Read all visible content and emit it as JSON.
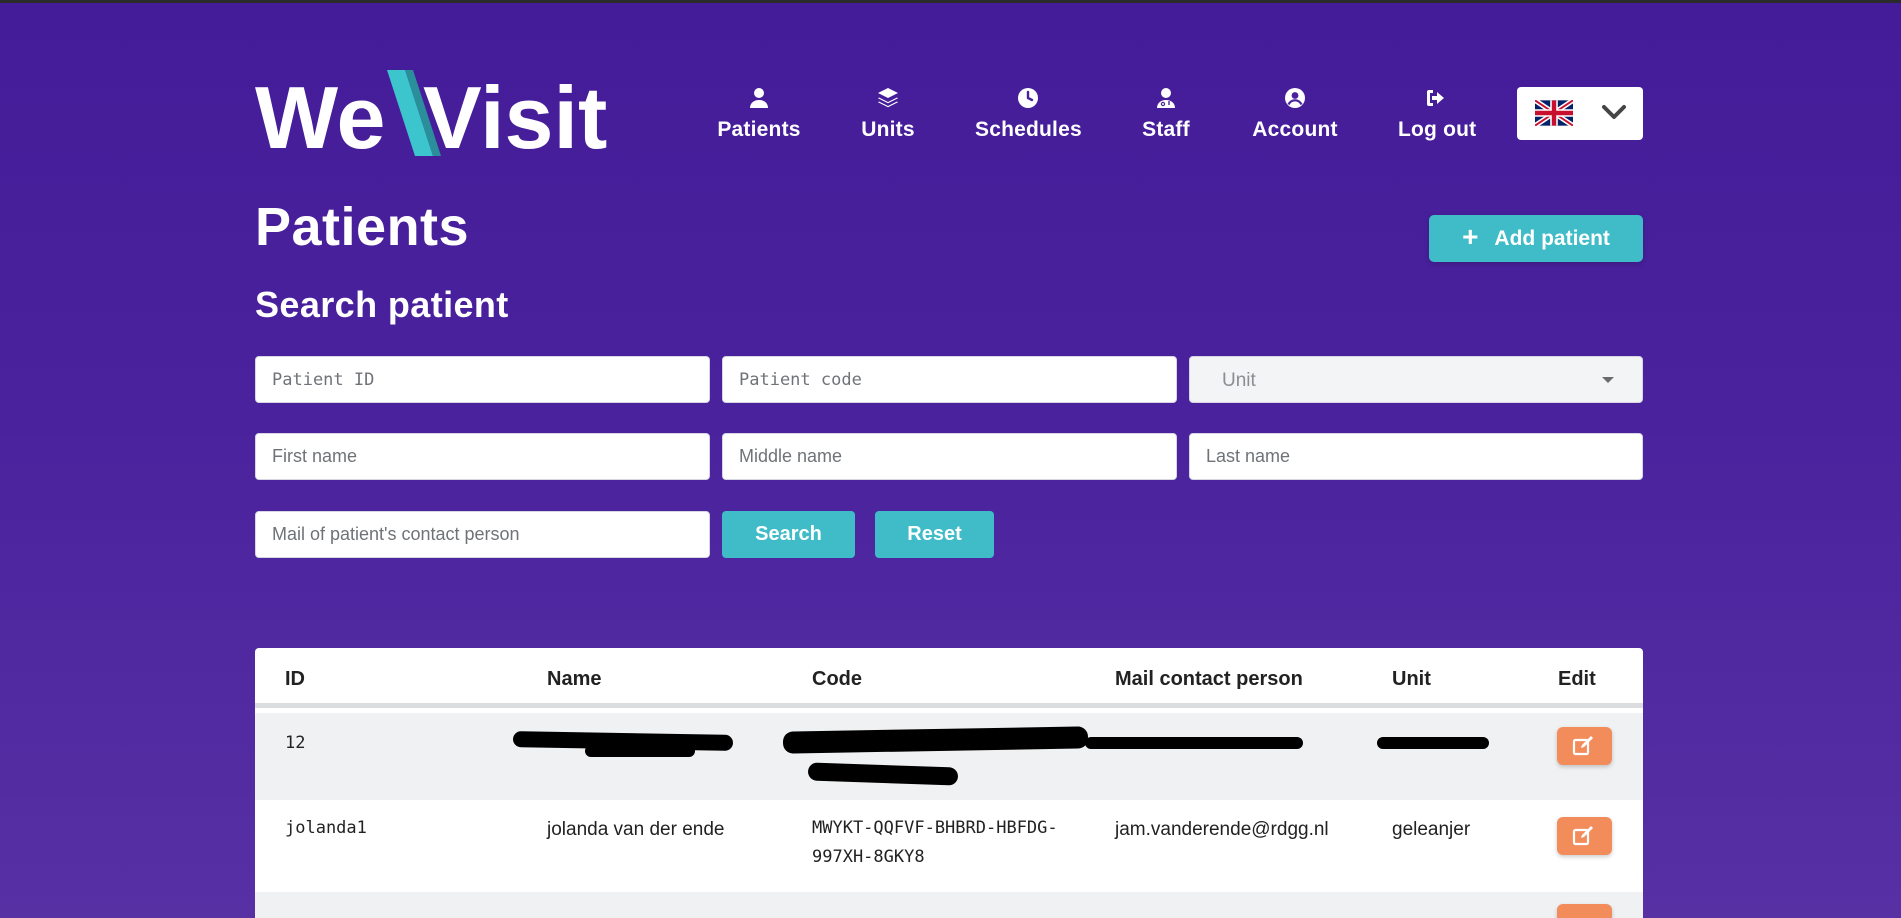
{
  "app": {
    "brand_left": "We",
    "brand_right": "Visit"
  },
  "nav": {
    "items": [
      {
        "label": "Patients",
        "icon": "user-icon"
      },
      {
        "label": "Units",
        "icon": "layers-icon"
      },
      {
        "label": "Schedules",
        "icon": "clock-icon"
      },
      {
        "label": "Staff",
        "icon": "user-md-icon"
      },
      {
        "label": "Account",
        "icon": "user-circle-icon"
      },
      {
        "label": "Log out",
        "icon": "sign-out-icon"
      }
    ],
    "language_icon": "uk-flag-icon"
  },
  "page": {
    "title": "Patients",
    "add_button": "Add patient",
    "search_title": "Search patient"
  },
  "search": {
    "patient_id_placeholder": "Patient ID",
    "patient_code_placeholder": "Patient code",
    "unit_placeholder": "Unit",
    "first_name_placeholder": "First name",
    "middle_name_placeholder": "Middle name",
    "last_name_placeholder": "Last name",
    "mail_placeholder": "Mail of patient's contact person",
    "search_button": "Search",
    "reset_button": "Reset"
  },
  "table": {
    "headers": [
      "ID",
      "Name",
      "Code",
      "Mail contact person",
      "Unit",
      "Edit"
    ],
    "rows": [
      {
        "id": "12",
        "name": "",
        "code": "",
        "mail": "",
        "unit": "",
        "redacted": true
      },
      {
        "id": "jolanda1",
        "name": "jolanda van der ende",
        "code_line1": "MWYKT-QQFVF-BHBRD-HBFDG-",
        "code_line2": "997XH-8GKY8",
        "mail": "jam.vanderende@rdgg.nl",
        "unit": "geleanjer"
      }
    ]
  },
  "colors": {
    "background": "#4a229d",
    "accent_teal": "#3fbcc8",
    "edit_orange": "#f28c5b"
  }
}
